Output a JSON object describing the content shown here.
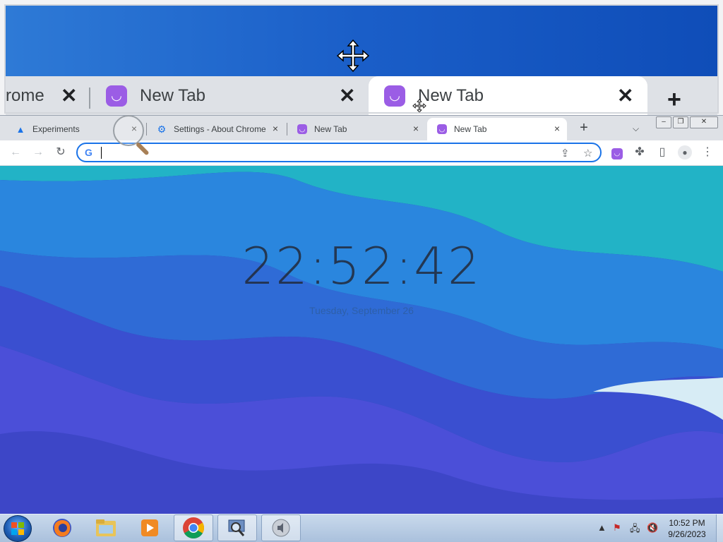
{
  "magnifier": {
    "tabs": [
      {
        "label": "rome"
      },
      {
        "label": "New Tab"
      },
      {
        "label": "New Tab"
      }
    ]
  },
  "chrome": {
    "tabs": [
      {
        "label": "Experiments",
        "icon": "flask-icon"
      },
      {
        "label": "Settings - About Chrome",
        "icon": "gear-icon"
      },
      {
        "label": "New Tab",
        "icon": "extension-face-icon"
      },
      {
        "label": "New Tab",
        "icon": "extension-face-icon",
        "active": true
      }
    ],
    "omnibox": {
      "value": "",
      "placeholder": ""
    },
    "accent": "#1a73e8",
    "extension_color": "#9b5de5"
  },
  "page": {
    "clock": "22:52:42",
    "date": "Tuesday, September 26"
  },
  "taskbar": {
    "time": "10:52 PM",
    "date": "9/26/2023"
  }
}
